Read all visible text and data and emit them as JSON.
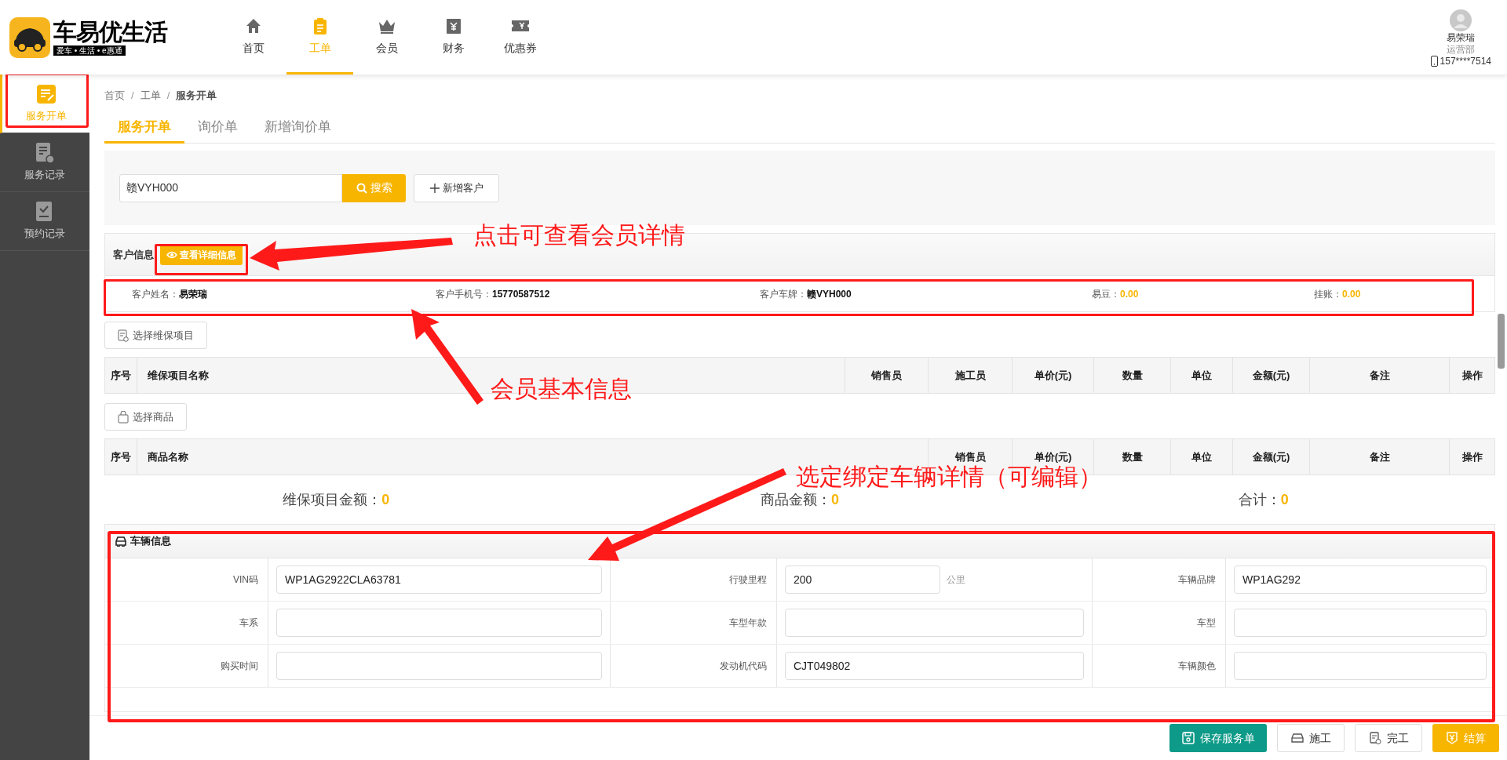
{
  "logo": {
    "name": "车易优生活",
    "tagline": "爱车 • 生活 • e惠通"
  },
  "nav": [
    {
      "label": "首页",
      "selected": false
    },
    {
      "label": "工单",
      "selected": true
    },
    {
      "label": "会员",
      "selected": false
    },
    {
      "label": "财务",
      "selected": false
    },
    {
      "label": "优惠券",
      "selected": false
    }
  ],
  "user": {
    "name": "易荣瑞",
    "department": "运营部",
    "phone": "157****7514"
  },
  "sidebar": {
    "items": [
      {
        "label": "服务开单",
        "selected": true
      },
      {
        "label": "服务记录",
        "selected": false
      },
      {
        "label": "预约记录",
        "selected": false
      }
    ]
  },
  "breadcrumb": {
    "separator": "/",
    "items": [
      "首页",
      "工单",
      "服务开单"
    ]
  },
  "tabs": [
    {
      "label": "服务开单",
      "selected": true
    },
    {
      "label": "询价单",
      "selected": false
    },
    {
      "label": "新增询价单",
      "selected": false
    }
  ],
  "search": {
    "value": "赣VYH000",
    "button": "搜索",
    "add_button": "新增客户"
  },
  "customer": {
    "title": "客户信息",
    "detail_button": "查看详细信息",
    "fields": [
      {
        "label": "客户姓名：",
        "value": "易荣瑞",
        "kind": "text"
      },
      {
        "label": "客户手机号：",
        "value": "15770587512",
        "kind": "text"
      },
      {
        "label": "客户车牌：",
        "value": "赣VYH000",
        "kind": "text"
      },
      {
        "label": "易豆：",
        "value": "0.00",
        "kind": "amount"
      },
      {
        "label": "挂账：",
        "value": "0.00",
        "kind": "amount"
      }
    ]
  },
  "service_items": {
    "button": "选择维保项目",
    "columns": [
      "序号",
      "维保项目名称",
      "销售员",
      "施工员",
      "单价(元)",
      "数量",
      "单位",
      "金额(元)",
      "备注",
      "操作"
    ]
  },
  "products": {
    "button": "选择商品",
    "columns": [
      "序号",
      "商品名称",
      "销售员",
      "单价(元)",
      "数量",
      "单位",
      "金额(元)",
      "备注",
      "操作"
    ]
  },
  "totals": [
    {
      "label": "维保项目金额：",
      "value": "0"
    },
    {
      "label": "商品金额：",
      "value": "0"
    },
    {
      "label": "合计：",
      "value": "0"
    }
  ],
  "vehicle": {
    "title": "车辆信息",
    "rows": [
      [
        {
          "label": "VIN码",
          "value": "WP1AG2922CLA63781"
        },
        {
          "label": "行驶里程",
          "value": "200",
          "unit": "公里"
        },
        {
          "label": "车辆品牌",
          "value": "WP1AG292"
        }
      ],
      [
        {
          "label": "车系"
        },
        {
          "label": "车型年款"
        },
        {
          "label": "车型"
        }
      ],
      [
        {
          "label": "购买时间"
        },
        {
          "label": "发动机代码",
          "value": "CJT049802"
        },
        {
          "label": "车辆颜色"
        }
      ]
    ]
  },
  "actions": [
    {
      "label": "保存服务单",
      "kind": "primary"
    },
    {
      "label": "施工",
      "kind": "default"
    },
    {
      "label": "完工",
      "kind": "default"
    },
    {
      "label": "结算",
      "kind": "accent"
    }
  ],
  "annotations": [
    "点击可查看会员详情",
    "会员基本信息",
    "选定绑定车辆详情（可编辑）"
  ]
}
